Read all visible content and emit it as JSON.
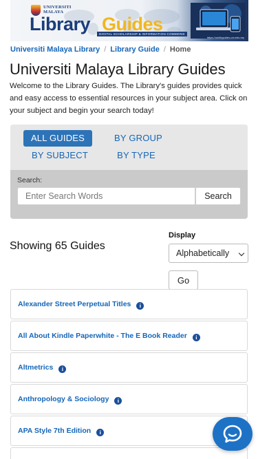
{
  "banner": {
    "university_line1": "UNIVERSITI",
    "university_line2": "MALAYA",
    "title_part1": "Library",
    "title_part2": "Guides",
    "tagline": "DIGITAL SCHOLARSHIP & INFORMATION COMMONS",
    "url": "https://umlibguides.um.edu.my"
  },
  "breadcrumb": {
    "items": [
      "Universiti Malaya Library",
      "Library Guide",
      "Home"
    ],
    "separator": "/"
  },
  "page": {
    "title": "Universiti Malaya Library Guides",
    "intro": "Welcome to the Library Guides. The Library's guides provides quick and easy access to essential resources in your subject area. Click on your subject and begin your search today!"
  },
  "filter": {
    "tabs": [
      "ALL GUIDES",
      "BY GROUP",
      "BY SUBJECT",
      "BY TYPE"
    ],
    "active_tab": "ALL GUIDES",
    "search_label": "Search:",
    "search_placeholder": "Enter Search Words",
    "search_button": "Search"
  },
  "results": {
    "showing_text": "Showing 65 Guides",
    "display_label": "Display",
    "display_selected": "Alphabetically",
    "go_button": "Go"
  },
  "guides": [
    "Alexander Street Perpetual Titles",
    "All About Kindle Paperwhite - The E Book Reader",
    "Altmetrics",
    "Anthropology & Sociology",
    "APA Style 7th Edition"
  ],
  "icons": {
    "info": "info-icon",
    "chat": "chat-icon"
  },
  "colors": {
    "link_blue": "#1566b7",
    "active_tab": "#2d73b8",
    "chat_button": "#1d72c6",
    "brand_navy": "#1b3d7a",
    "brand_gold": "#f2b71f"
  }
}
